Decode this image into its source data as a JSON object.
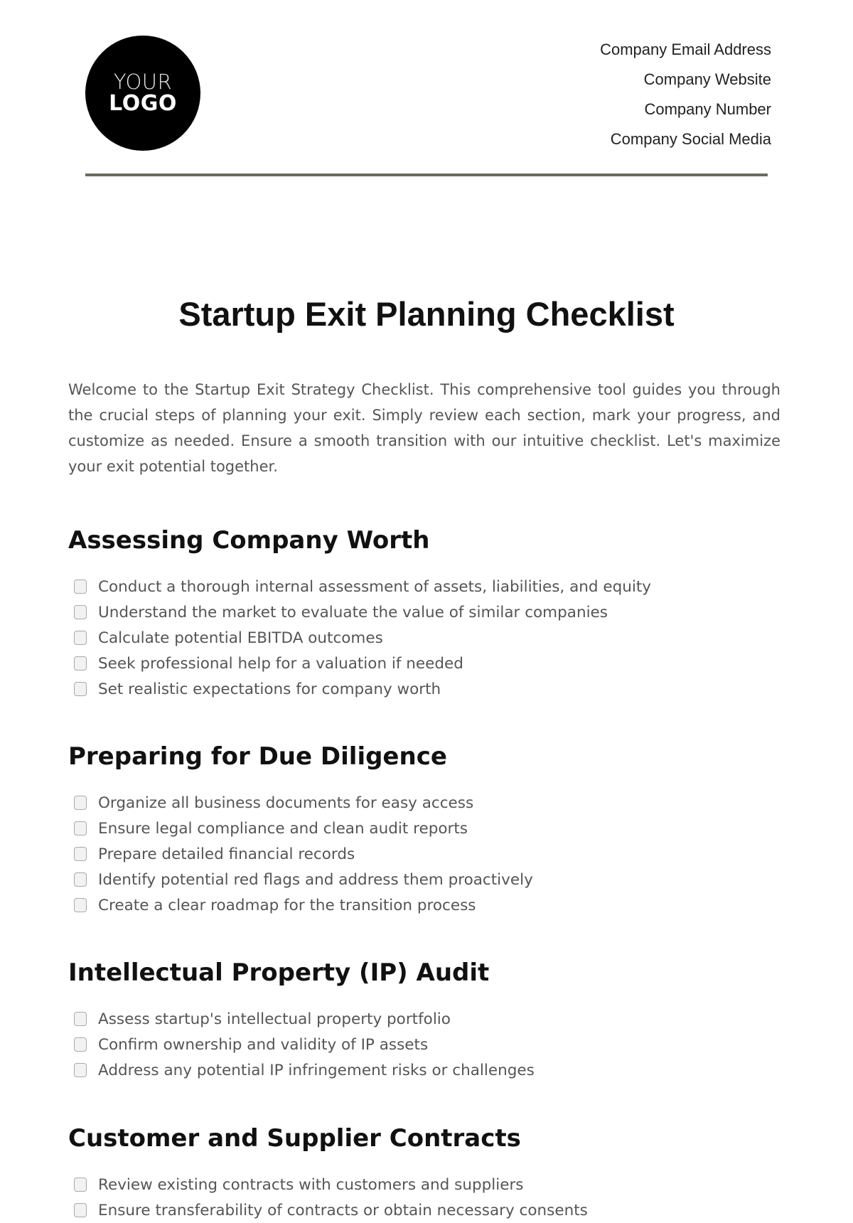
{
  "header": {
    "logo": {
      "line1": "YOUR",
      "line2": "LOGO"
    },
    "contact": [
      "Company Email Address",
      "Company Website",
      "Company Number",
      "Company Social Media"
    ]
  },
  "title": "Startup Exit Planning Checklist",
  "intro": "Welcome to the Startup Exit Strategy Checklist. This comprehensive tool guides you through the crucial steps of planning your exit. Simply review each section, mark your progress, and customize as needed. Ensure a smooth transition with our intuitive checklist. Let's maximize your exit potential together.",
  "sections": [
    {
      "heading": "Assessing Company Worth",
      "items": [
        "Conduct a thorough internal assessment of assets, liabilities, and equity",
        "Understand the market to evaluate the value of similar companies",
        "Calculate potential EBITDA outcomes",
        "Seek professional help for a valuation if needed",
        "Set realistic expectations for company worth"
      ]
    },
    {
      "heading": "Preparing for Due Diligence",
      "items": [
        "Organize all business documents for easy access",
        "Ensure legal compliance and clean audit reports",
        "Prepare detailed financial records",
        "Identify potential red flags and address them proactively",
        "Create a clear roadmap for the transition process"
      ]
    },
    {
      "heading": "Intellectual Property (IP) Audit",
      "items": [
        "Assess startup's intellectual property portfolio",
        "Confirm ownership and validity of IP assets",
        "Address any potential IP infringement risks or challenges"
      ]
    },
    {
      "heading": "Customer and Supplier Contracts",
      "items": [
        "Review existing contracts with customers and suppliers",
        "Ensure transferability of contracts or obtain necessary consents"
      ]
    }
  ]
}
